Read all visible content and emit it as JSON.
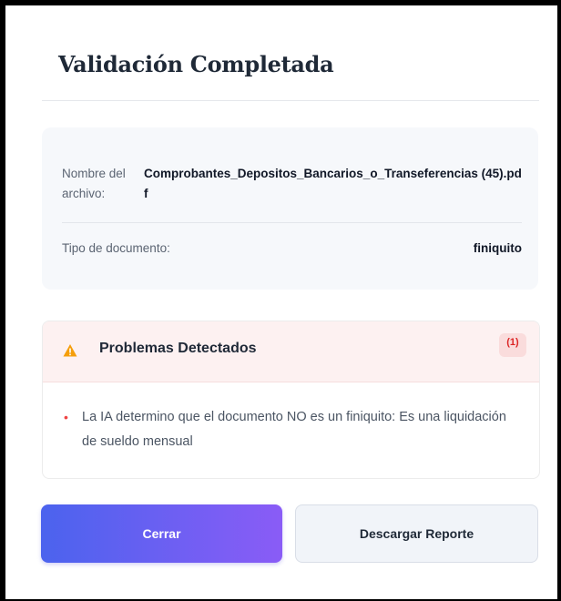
{
  "dialog": {
    "title": "Validación Completada"
  },
  "file_info": {
    "filename_label": "Nombre del archivo:",
    "filename_value": "Comprobantes_Depositos_Bancarios_o_Transeferencias (45).pdf",
    "doctype_label": "Tipo de documento:",
    "doctype_value": "finiquito"
  },
  "problems": {
    "title": "Problemas Detectados",
    "count": "(1)",
    "items": [
      "La IA determino que el documento NO es un finiquito: Es una liquidación de sueldo mensual"
    ]
  },
  "actions": {
    "close_label": "Cerrar",
    "download_label": "Descargar Reporte"
  },
  "colors": {
    "primary_gradient_start": "#4b63ee",
    "primary_gradient_end": "#8a5cf6",
    "warning": "#f59e0b",
    "error": "#dc2626"
  },
  "icons": {
    "warning": "warning-triangle-icon",
    "bullet": "bullet-dot"
  }
}
